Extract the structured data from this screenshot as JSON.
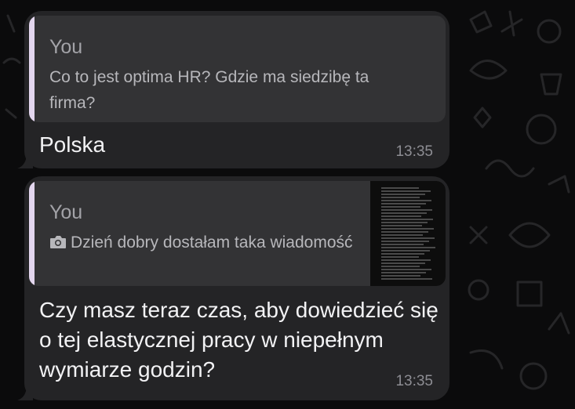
{
  "messages": [
    {
      "reply": {
        "author": "You",
        "text": "Co to jest optima HR? Gdzie ma siedzibę ta firma?"
      },
      "text": "Polska",
      "time": "13:35"
    },
    {
      "reply": {
        "author": "You",
        "text": "Dzień dobry dostałam taka wiadomość",
        "icon": "camera-icon",
        "has_thumbnail": true
      },
      "text": "Czy masz teraz czas, aby dowiedzieć się o tej elastycznej pracy w niepełnym wymiarze godzin?",
      "time": "13:35"
    }
  ],
  "colors": {
    "background": "#0b0b0c",
    "bubble": "#242426",
    "quote": "#333335",
    "quote_bar": "#e3d6ee",
    "message_text": "#f2f2f4",
    "timestamp": "#8d8d93"
  }
}
